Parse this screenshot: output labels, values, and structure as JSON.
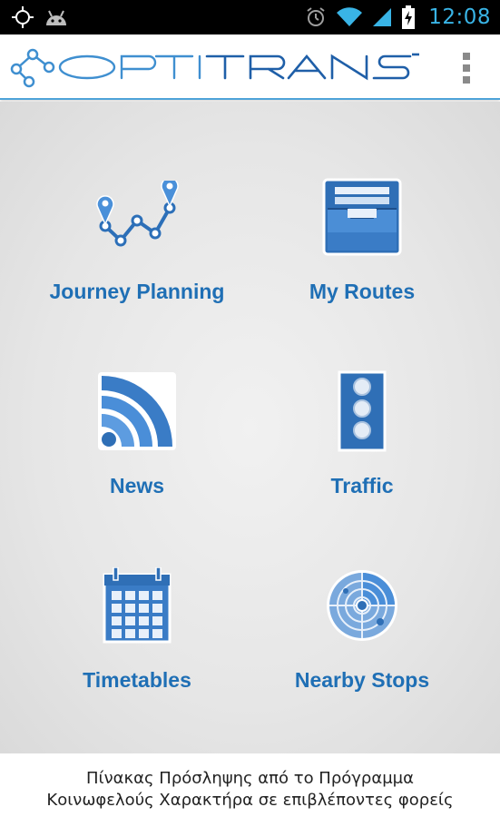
{
  "status_bar": {
    "time": "12:08",
    "icons_left": [
      "gps-icon",
      "android-icon"
    ],
    "icons_right": [
      "alarm-icon",
      "wifi-icon",
      "signal-icon",
      "battery-charging-icon"
    ],
    "clock_color": "#39b4e6"
  },
  "app": {
    "logo_text": "OPTITRANS",
    "menu_icon": "overflow-menu-icon",
    "accent_color": "#1f6fb5"
  },
  "tiles": [
    {
      "label": "Journey Planning",
      "icon": "journey-route-icon"
    },
    {
      "label": "My Routes",
      "icon": "file-tray-icon"
    },
    {
      "label": "News",
      "icon": "rss-feed-icon"
    },
    {
      "label": "Traffic",
      "icon": "traffic-light-icon"
    },
    {
      "label": "Timetables",
      "icon": "calendar-icon"
    },
    {
      "label": "Nearby Stops",
      "icon": "radar-icon"
    }
  ],
  "footer": {
    "line1": "Πίνακας Πρόσληψης από το Πρόγραμμα",
    "line2": "Κοινωφελούς Χαρακτήρα σε επιβλέποντες φορείς"
  }
}
